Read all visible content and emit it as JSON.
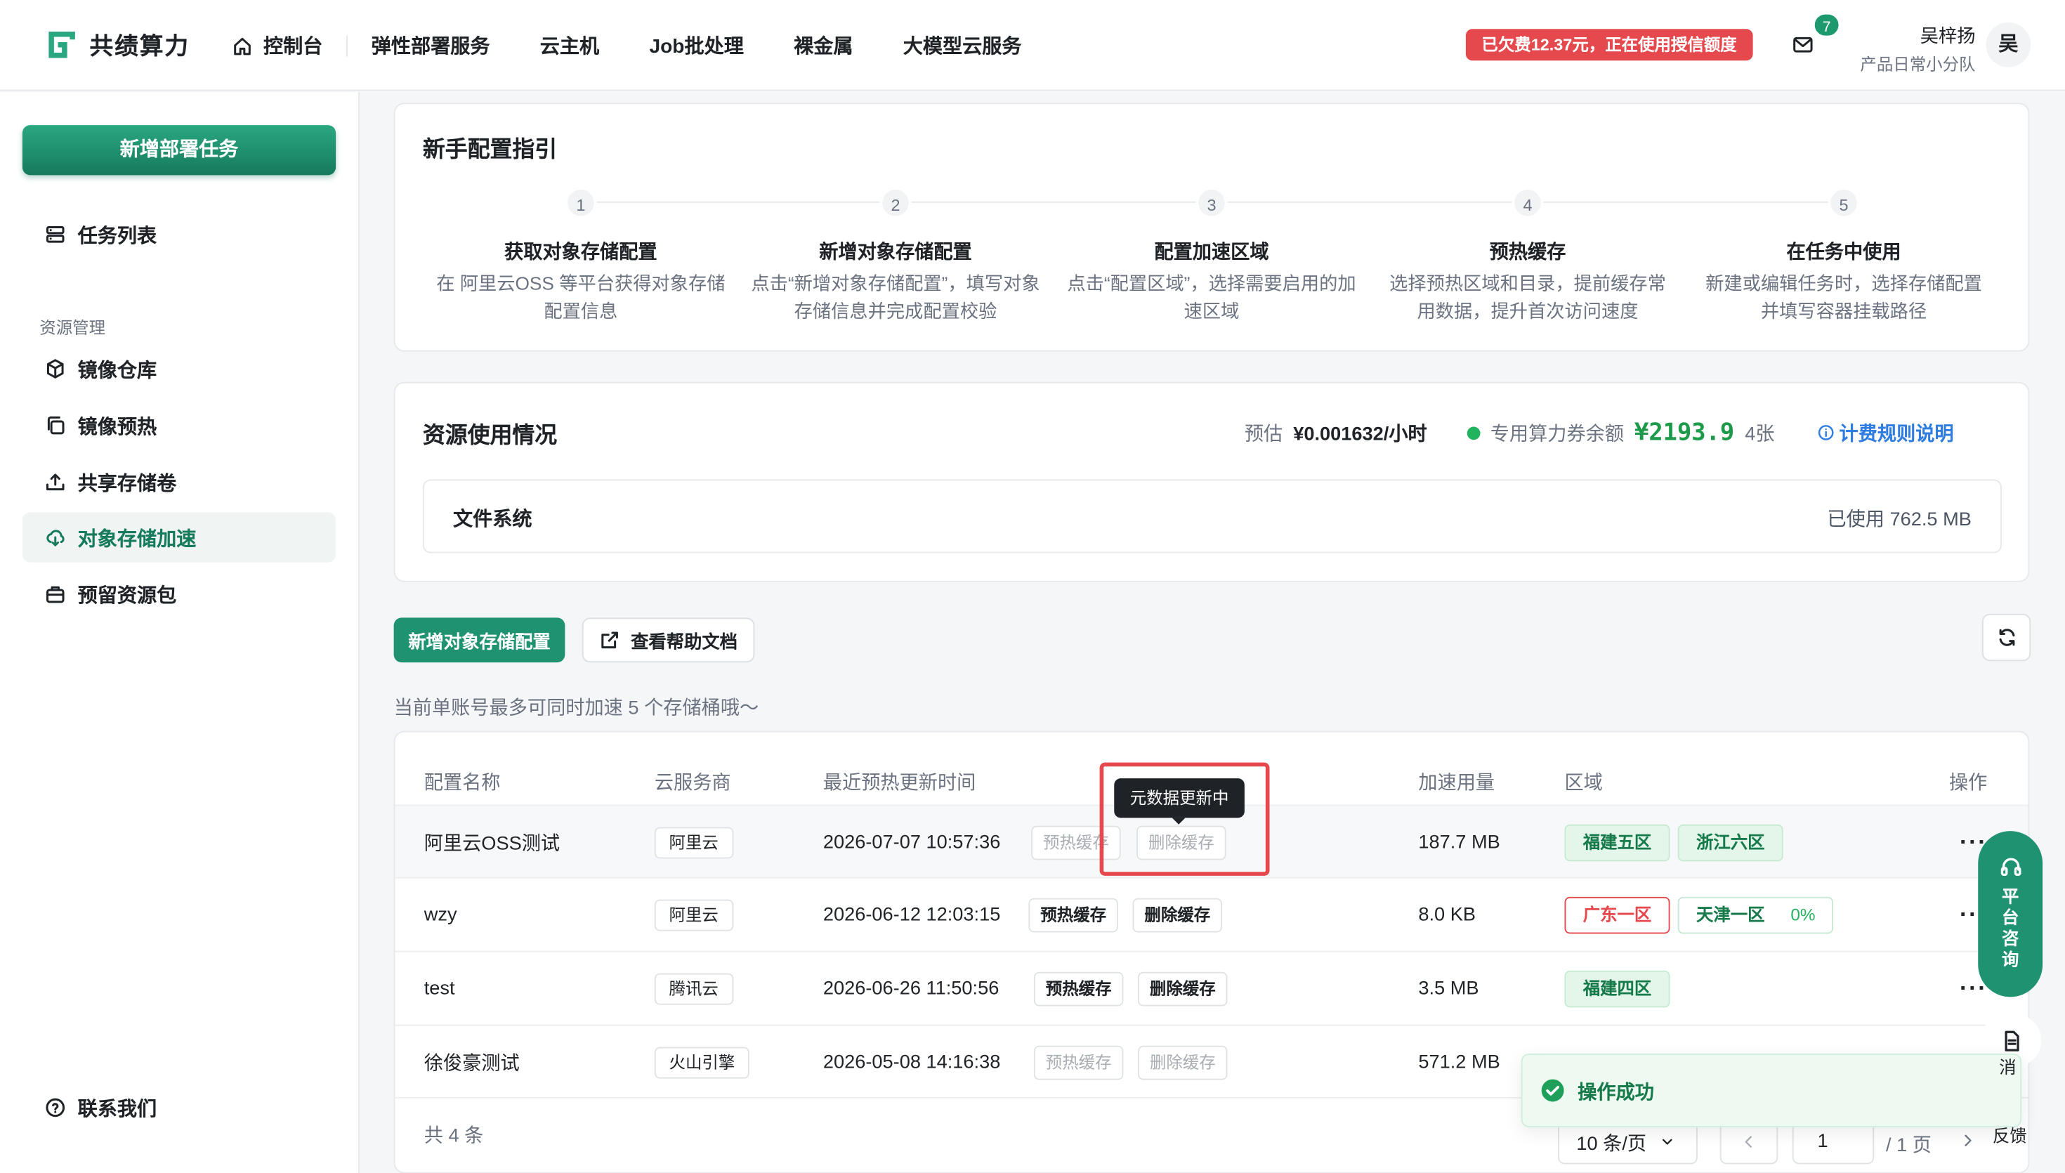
{
  "header": {
    "brand": "共绩算力",
    "nav": [
      "控制台",
      "弹性部署服务",
      "云主机",
      "Job批处理",
      "裸金属",
      "大模型云服务"
    ],
    "debt_notice": "已欠费12.37元，正在使用授信额度",
    "mail_count": "7",
    "user_name": "吴梓扬",
    "user_team": "产品日常小分队",
    "avatar_text": "吴"
  },
  "sidebar": {
    "new_task": "新增部署任务",
    "task_list": "任务列表",
    "section": "资源管理",
    "items": [
      "镜像仓库",
      "镜像预热",
      "共享存储卷",
      "对象存储加速",
      "预留资源包"
    ],
    "contact": "联系我们"
  },
  "guide": {
    "title": "新手配置指引",
    "steps": [
      {
        "num": "1",
        "title": "获取对象存储配置",
        "desc": "在 阿里云OSS 等平台获得对象存储配置信息"
      },
      {
        "num": "2",
        "title": "新增对象存储配置",
        "desc": "点击“新增对象存储配置”，填写对象存储信息并完成配置校验"
      },
      {
        "num": "3",
        "title": "配置加速区域",
        "desc": "点击“配置区域”，选择需要启用的加速区域"
      },
      {
        "num": "4",
        "title": "预热缓存",
        "desc": "选择预热区域和目录，提前缓存常用数据，提升首次访问速度"
      },
      {
        "num": "5",
        "title": "在任务中使用",
        "desc": "新建或编辑任务时，选择存储配置并填写容器挂载路径"
      }
    ]
  },
  "usage": {
    "title": "资源使用情况",
    "estimate_label": "预估",
    "estimate_value": "¥0.001632/小时",
    "coupon_label": "专用算力券余额",
    "coupon_value": "¥2193.9",
    "coupon_count": "4张",
    "billing_link": "计费规则说明",
    "fs_label": "文件系统",
    "fs_used": "已使用 762.5 MB"
  },
  "actions": {
    "add_config": "新增对象存储配置",
    "help_doc": "查看帮助文档",
    "limit_note": "当前单账号最多可同时加速 5 个存储桶哦～"
  },
  "table": {
    "headers": [
      "配置名称",
      "云服务商",
      "最近预热更新时间",
      "加速用量",
      "区域",
      "操作"
    ],
    "preheat_label": "预热缓存",
    "delete_label": "删除缓存",
    "rows": [
      {
        "name": "阿里云OSS测试",
        "provider": "阿里云",
        "time": "2026-07-07 10:57:36",
        "usage": "187.7 MB",
        "regions": [
          {
            "label": "福建五区",
            "pct": ""
          },
          {
            "label": "浙江六区",
            "pct": ""
          }
        ]
      },
      {
        "name": "wzy",
        "provider": "阿里云",
        "time": "2026-06-12 12:03:15",
        "usage": "8.0 KB",
        "regions": [
          {
            "label": "广东一区",
            "pct": ""
          },
          {
            "label": "天津一区",
            "pct": "0%"
          }
        ]
      },
      {
        "name": "test",
        "provider": "腾讯云",
        "time": "2026-06-26 11:50:56",
        "usage": "3.5 MB",
        "regions": [
          {
            "label": "福建四区",
            "pct": ""
          }
        ]
      },
      {
        "name": "徐俊豪测试",
        "provider": "火山引擎",
        "time": "2026-05-08 14:16:38",
        "usage": "571.2 MB",
        "regions": []
      }
    ],
    "more": "···",
    "total": "共 4 条",
    "page_size": "10 条/页",
    "page": "1",
    "page_total": "/ 1 页"
  },
  "tooltip": "元数据更新中",
  "consult": [
    "平",
    "台",
    "咨",
    "询"
  ],
  "toast": "操作成功",
  "feedback_top": "消",
  "feedback": "反馈",
  "colors": {
    "brand": "#1f9271",
    "danger": "#e5484d",
    "coupon": "#1c9a4a",
    "link": "#2f7de1"
  }
}
